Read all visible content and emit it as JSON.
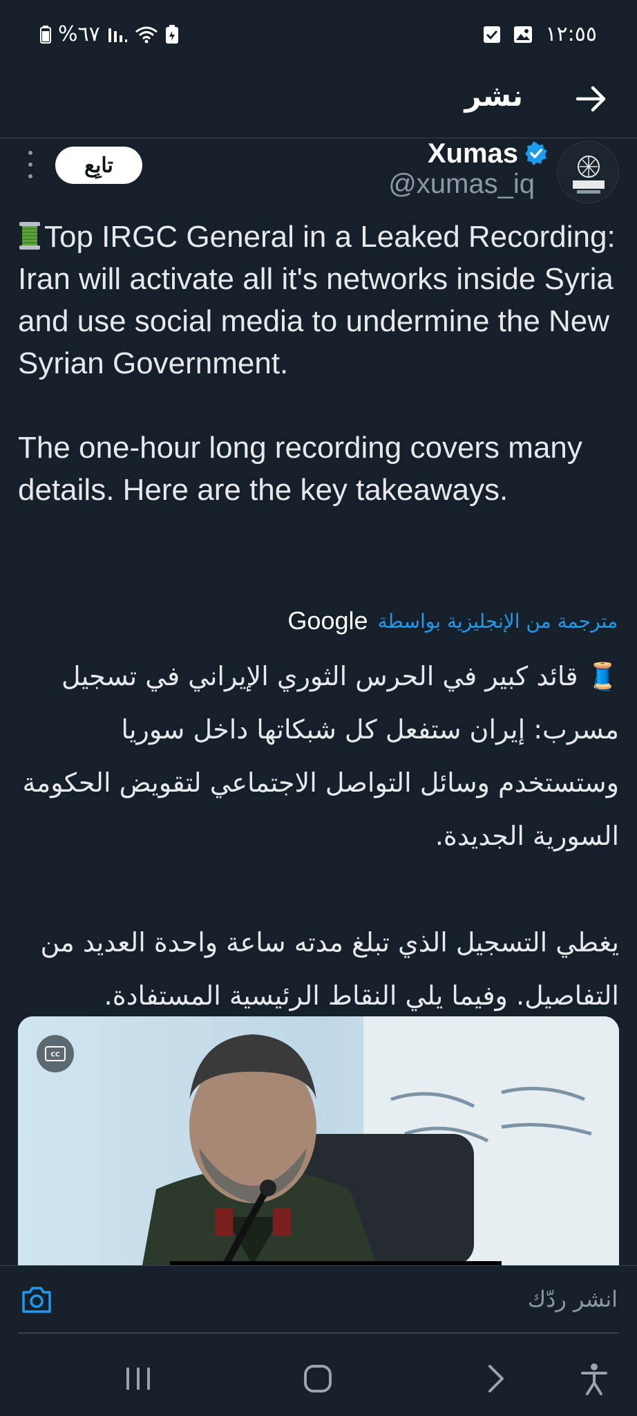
{
  "status_bar": {
    "time": "١٢:٥٥",
    "battery": "%٦٧"
  },
  "header": {
    "title": "نشر"
  },
  "tweet": {
    "display_name": "Xumas",
    "handle": "@xumas_iq",
    "follow_label": "تابِع",
    "text": "Top IRGC General in a Leaked Recording: Iran will activate all it's networks inside Syria and use social media to undermine the New Syrian Government.\n\nThe one-hour long recording covers many details. Here are the key takeaways.",
    "translated_by": "مترجمة من الإنجليزية بواسطة",
    "translator": "Google",
    "arabic_text": "🧵 قائد كبير في الحرس الثوري الإيراني في تسجيل مسرب: إيران ستفعل كل شبكاتها داخل سوريا وستستخدم وسائل التواصل الاجتماعي لتقويض الحكومة السورية الجديدة.\n\nيغطي التسجيل الذي تبلغ مدته ساعة واحدة العديد من التفاصيل. وفيما يلي النقاط الرئيسية المستفادة."
  },
  "media": {
    "cc_label": "CC"
  },
  "reply": {
    "placeholder": "انشر ردّك"
  },
  "colors": {
    "background": "#15202b",
    "accent": "#1d9bf0",
    "muted": "#8b98a5",
    "text": "#e7e9ea"
  },
  "icons": [
    "back-arrow-icon",
    "verified-badge-icon",
    "more-options-icon",
    "spool-thread-icon",
    "closed-captions-icon",
    "camera-icon",
    "recents-icon",
    "home-icon",
    "back-icon",
    "accessibility-icon"
  ]
}
